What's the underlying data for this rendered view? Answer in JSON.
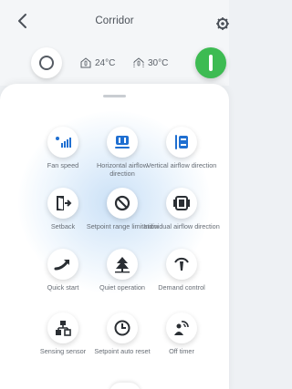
{
  "header": {
    "title": "Corridor"
  },
  "status": {
    "indoor_temp": "24°C",
    "outdoor_temp": "30°C",
    "power_color": "#3dbb52"
  },
  "icons": {
    "back": "chevron-left-icon",
    "settings": "gear-icon",
    "mode": "circle-icon",
    "power": "power-icon"
  },
  "functions": [
    {
      "label": "Fan speed",
      "icon": "fan-speed-icon"
    },
    {
      "label": "Horizontal airflow direction",
      "icon": "horizontal-airflow-icon"
    },
    {
      "label": "Vertical airflow direction",
      "icon": "vertical-airflow-icon"
    },
    {
      "label": "Setback",
      "icon": "door-exit-icon"
    },
    {
      "label": "Setpoint range limitation",
      "icon": "prohibited-icon"
    },
    {
      "label": "Individual airflow direction",
      "icon": "individual-airflow-icon"
    },
    {
      "label": "Quick start",
      "icon": "arrow-curve-icon"
    },
    {
      "label": "Quiet operation",
      "icon": "tree-icon"
    },
    {
      "label": "Demand control",
      "icon": "gauge-icon"
    },
    {
      "label": "Sensing sensor",
      "icon": "sensor-network-icon"
    },
    {
      "label": "Setpoint auto reset",
      "icon": "clock-icon"
    },
    {
      "label": "Off timer",
      "icon": "person-timer-icon"
    }
  ]
}
